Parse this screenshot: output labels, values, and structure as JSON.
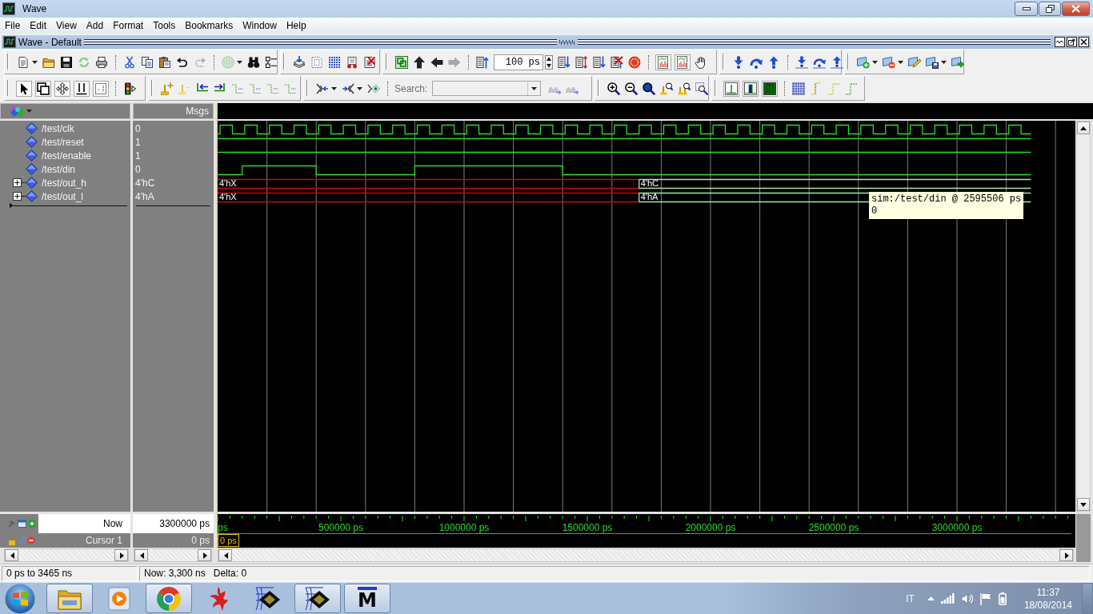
{
  "window": {
    "title": "Wave"
  },
  "menu": [
    "File",
    "Edit",
    "View",
    "Add",
    "Format",
    "Tools",
    "Bookmarks",
    "Window",
    "Help"
  ],
  "subwindow": {
    "title": "Wave - Default"
  },
  "toolbar": {
    "time_step": "100 ps",
    "search_label": "Search:"
  },
  "wave": {
    "values_header": "Msgs",
    "signals": [
      {
        "name": "/test/clk",
        "value": "0",
        "kind": "clock"
      },
      {
        "name": "/test/reset",
        "value": "1",
        "kind": "bit"
      },
      {
        "name": "/test/enable",
        "value": "1",
        "kind": "bit"
      },
      {
        "name": "/test/din",
        "value": "0",
        "kind": "bit"
      },
      {
        "name": "/test/out_h",
        "value": "4'hC",
        "kind": "bus",
        "expanded": false,
        "segments": [
          {
            "label": "4'hX",
            "kind": "unknown"
          },
          {
            "label": "4'hC",
            "kind": "known"
          }
        ]
      },
      {
        "name": "/test/out_l",
        "value": "4'hA",
        "kind": "bus",
        "expanded": false,
        "segments": [
          {
            "label": "4'hX",
            "kind": "unknown"
          },
          {
            "label": "4'hA",
            "kind": "known"
          }
        ]
      }
    ],
    "tooltip": {
      "title": "sim:/test/din @ 2595506 ps",
      "value": "0"
    },
    "ruler": [
      "ps",
      "500000 ps",
      "1000000 ps",
      "1500000 ps",
      "2000000 ps",
      "2500000 ps",
      "3000000 ps"
    ],
    "now": {
      "label": "Now",
      "value": "3300000 ps"
    },
    "cursor": {
      "label": "Cursor 1",
      "value": "0 ps",
      "marker": "0 ps"
    }
  },
  "status_bar": {
    "range": "0 ps to 3465 ns",
    "now": "Now: 3,300 ns",
    "delta": "Delta: 0"
  },
  "taskbar": {
    "apps": [
      {
        "running": true
      },
      {
        "running": false
      },
      {
        "running": true
      },
      {
        "running": false
      },
      {
        "running": false
      },
      {
        "running": true
      },
      {
        "running": true,
        "label": "M"
      }
    ],
    "language": "IT",
    "time": "11:37",
    "date": "18/08/2014"
  }
}
